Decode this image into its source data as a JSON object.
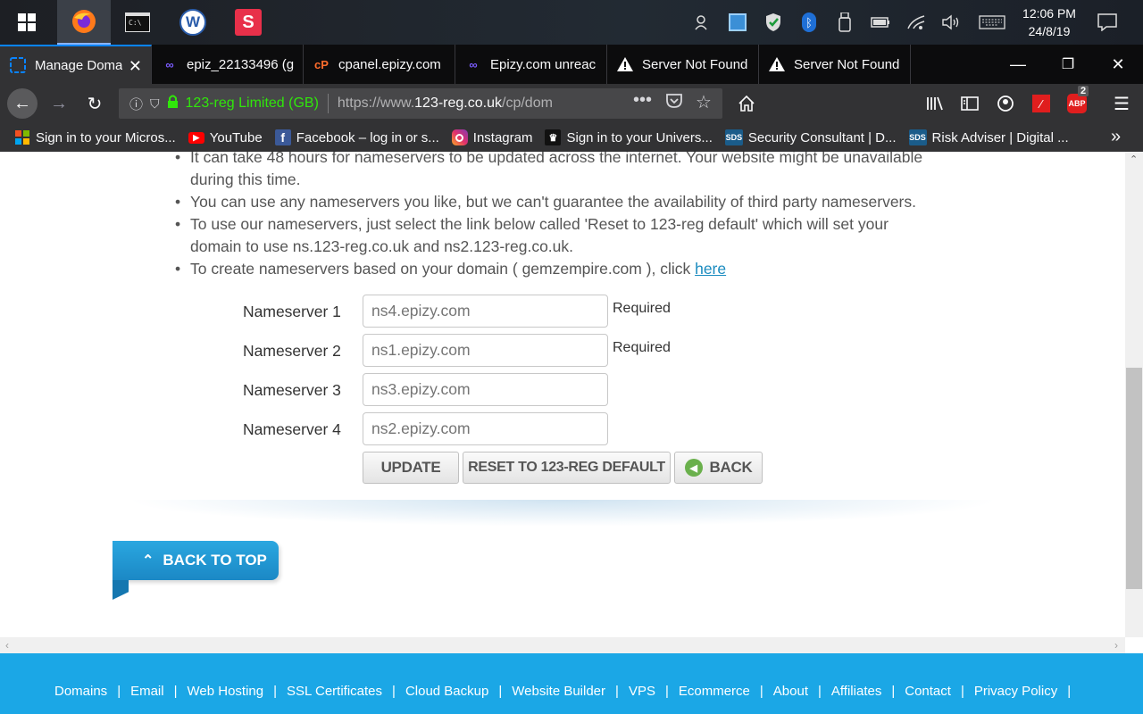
{
  "taskbar": {
    "apps": [
      {
        "name": "start-icon"
      },
      {
        "name": "firefox-icon"
      },
      {
        "name": "terminal-icon"
      },
      {
        "name": "w-app-icon",
        "letter": "W"
      },
      {
        "name": "s-app-icon",
        "letter": "S"
      }
    ],
    "clock_time": "12:06 PM",
    "clock_date": "24/8/19"
  },
  "tabs": [
    {
      "label": "Manage Doma",
      "active": true
    },
    {
      "label": "epiz_22133496 (g"
    },
    {
      "label": "cpanel.epizy.com"
    },
    {
      "label": "Epizy.com unreac"
    },
    {
      "label": "Server Not Found"
    },
    {
      "label": "Server Not Found"
    }
  ],
  "urlbar": {
    "identity": "123-reg Limited (GB)",
    "url_prefix": "https://www.",
    "url_domain": "123-reg.co.uk",
    "url_path": "/cp/dom"
  },
  "toolbar": {
    "badge_count": "2"
  },
  "bookmarks": [
    {
      "label": "Sign in to your Micros...",
      "icon": "microsoft-icon"
    },
    {
      "label": "YouTube",
      "icon": "youtube-icon"
    },
    {
      "label": "Facebook – log in or s...",
      "icon": "facebook-icon"
    },
    {
      "label": "Instagram",
      "icon": "instagram-icon"
    },
    {
      "label": "Sign in to your Univers...",
      "icon": "university-icon"
    },
    {
      "label": "Security Consultant | D...",
      "icon": "sds-icon",
      "badge": "SDS"
    },
    {
      "label": "Risk Adviser | Digital ...",
      "icon": "sds-icon",
      "badge": "SDS"
    }
  ],
  "content": {
    "bullets": [
      "It can take 48 hours for nameservers to be updated across the internet. Your website might be unavailable during this time.",
      "You can use any nameservers you like, but we can't guarantee the availability of third party nameservers.",
      "To use our nameservers, just select the link below called 'Reset to 123-reg default' which will set your domain to use ns.123-reg.co.uk and ns2.123-reg.co.uk."
    ],
    "bullet_last_prefix": "To create nameservers based on your domain ( gemzempire.com ), click ",
    "bullet_last_link": "here",
    "nameservers": [
      {
        "label": "Nameserver 1",
        "placeholder": "ns4.epizy.com",
        "required": "Required"
      },
      {
        "label": "Nameserver 2",
        "placeholder": "ns1.epizy.com",
        "required": "Required"
      },
      {
        "label": "Nameserver 3",
        "placeholder": "ns3.epizy.com"
      },
      {
        "label": "Nameserver 4",
        "placeholder": "ns2.epizy.com"
      }
    ],
    "buttons": {
      "update": "UPDATE",
      "reset": "RESET TO 123-REG DEFAULT",
      "back": "BACK"
    },
    "back_to_top": "BACK TO TOP"
  },
  "footer": {
    "links": [
      "Domains",
      "Email",
      "Web Hosting",
      "SSL Certificates",
      "Cloud Backup",
      "Website Builder",
      "VPS",
      "Ecommerce",
      "About",
      "Affiliates",
      "Contact",
      "Privacy Policy"
    ],
    "separator": "|"
  },
  "colors": {
    "accent": "#1ba7e6",
    "link": "#1a8bbf",
    "secure_green": "#30e60b"
  }
}
